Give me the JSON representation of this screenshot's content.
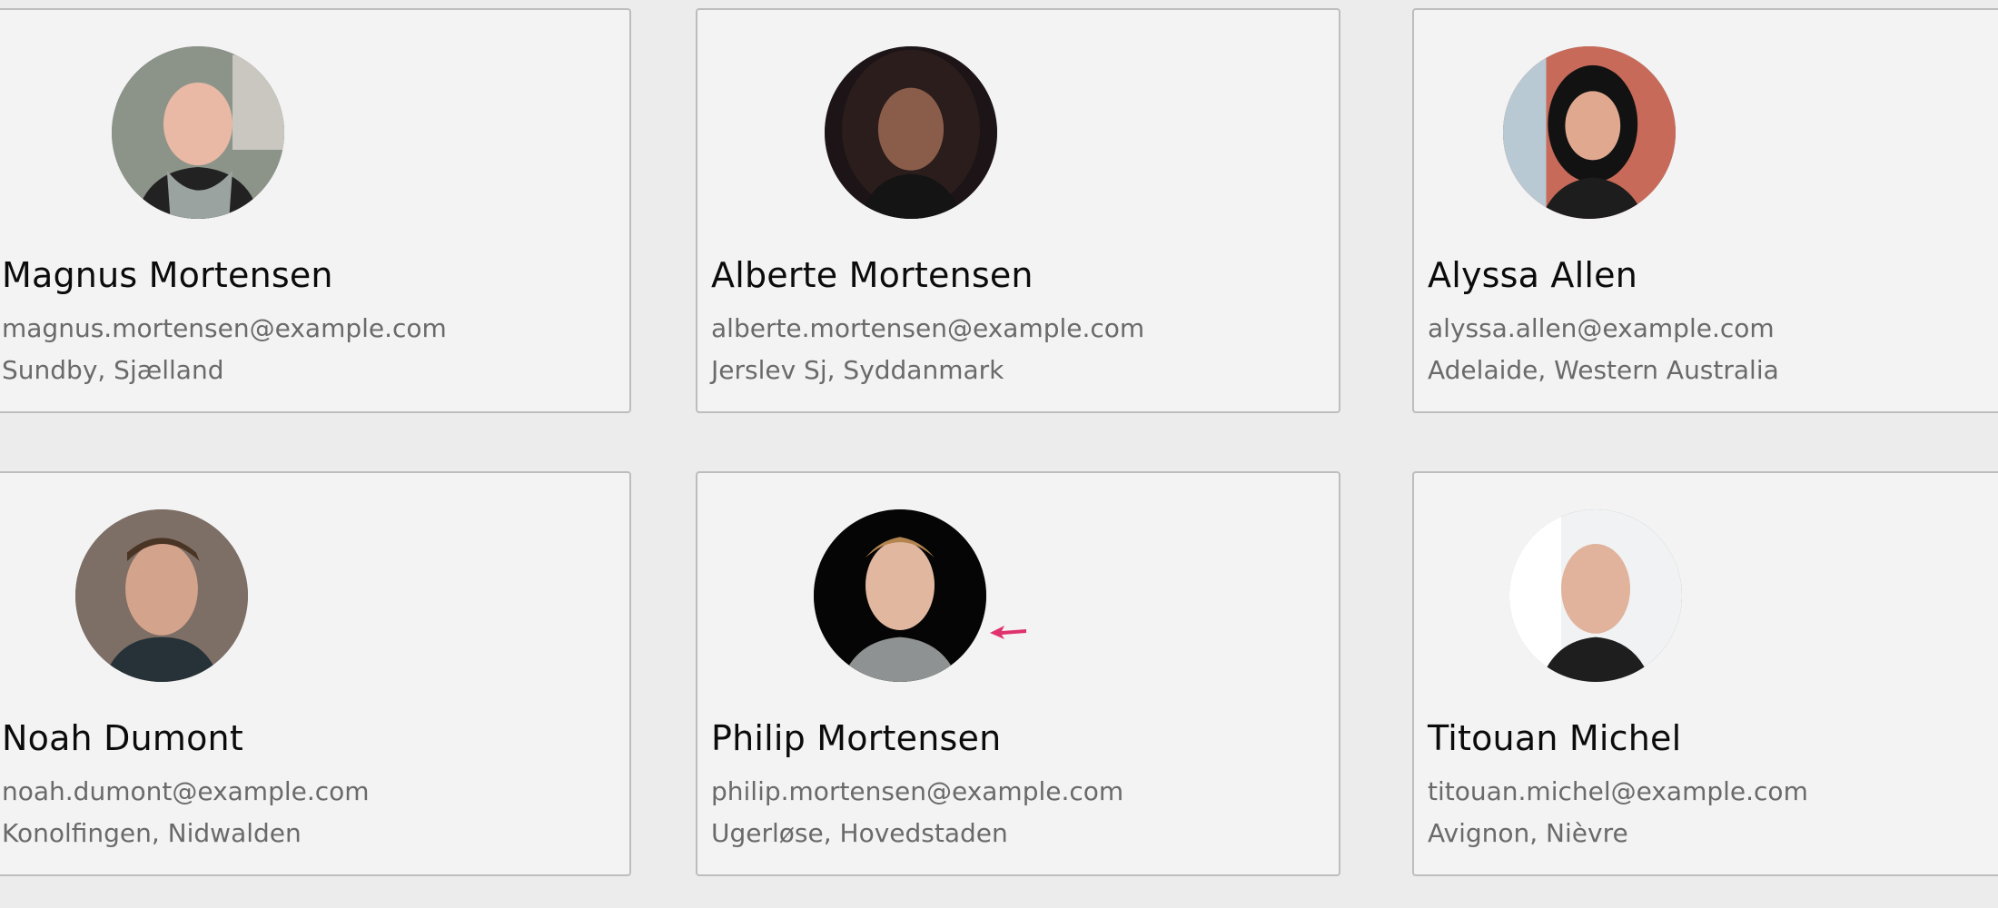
{
  "users": [
    {
      "name": "Magnus Mortensen",
      "email": "magnus.mortensen@example.com",
      "location": "Sundby, Sjælland"
    },
    {
      "name": "Alberte Mortensen",
      "email": "alberte.mortensen@example.com",
      "location": "Jerslev Sj, Syddanmark"
    },
    {
      "name": "Alyssa Allen",
      "email": "alyssa.allen@example.com",
      "location": "Adelaide, Western Australia"
    },
    {
      "name": "Noah Dumont",
      "email": "noah.dumont@example.com",
      "location": "Konolfingen, Nidwalden"
    },
    {
      "name": "Philip Mortensen",
      "email": "philip.mortensen@example.com",
      "location": "Ugerløse, Hovedstaden"
    },
    {
      "name": "Titouan Michel",
      "email": "titouan.michel@example.com",
      "location": "Avignon, Nièvre"
    }
  ],
  "colors": {
    "background": "#ececec",
    "card": "#f3f3f3",
    "card_border": "#bdbdbd",
    "name_text": "#0b0b0b",
    "meta_text": "#6a6a6a",
    "cursor": "#e0336e"
  },
  "icons": {
    "cursor": "pointer-arrow-icon"
  }
}
